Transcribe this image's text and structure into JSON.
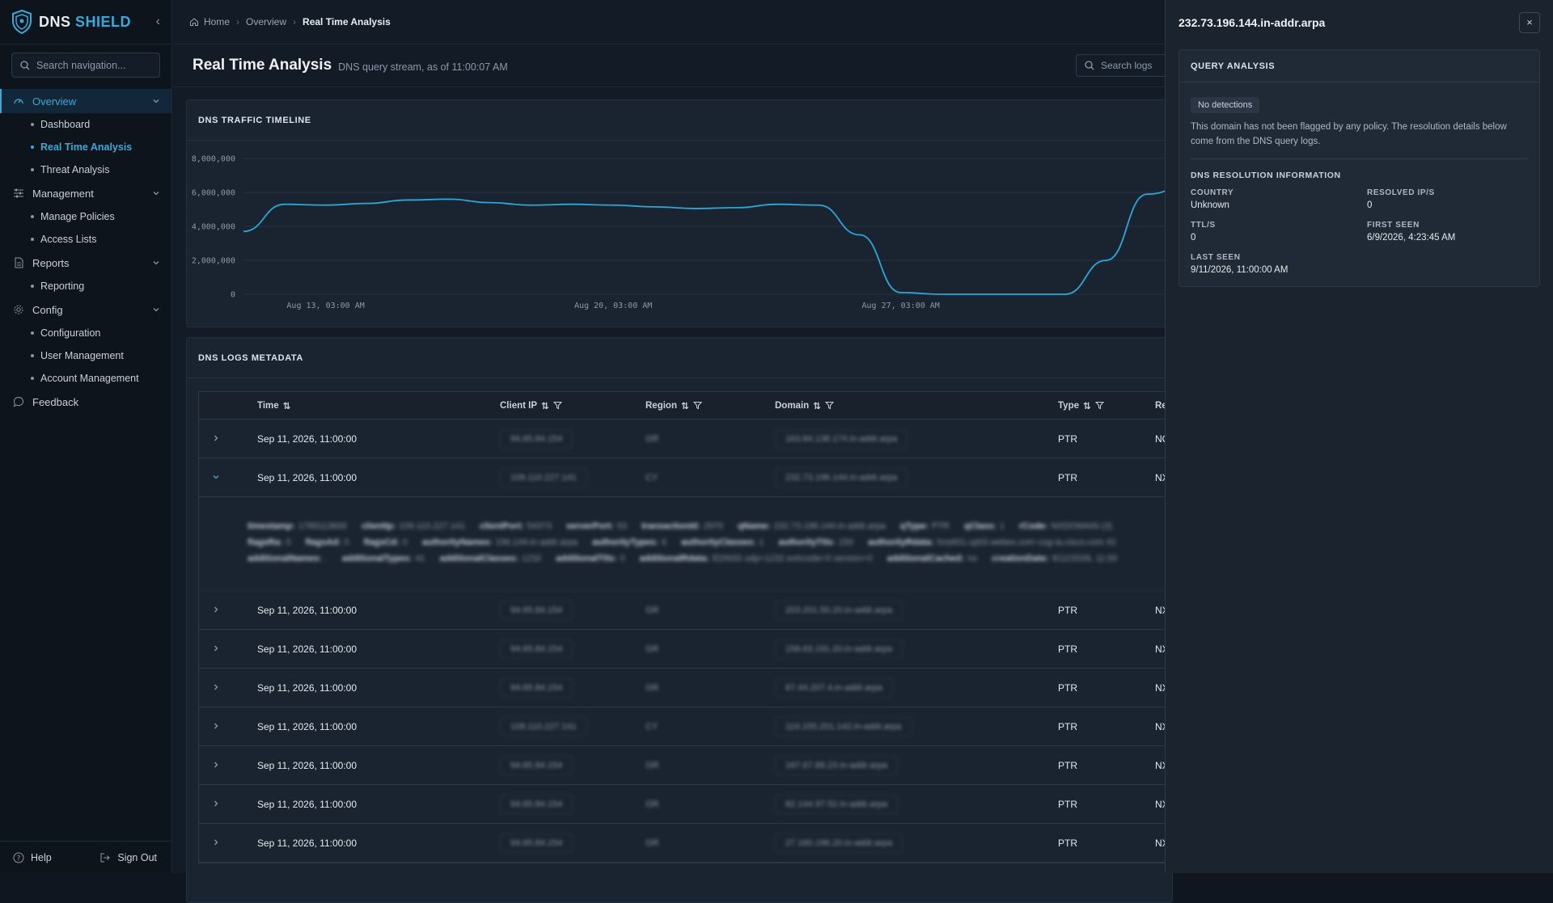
{
  "brand": {
    "name_part1": "DNS",
    "name_part2": "SHIELD"
  },
  "nav_search": {
    "placeholder": "Search navigation..."
  },
  "nav": {
    "overview": {
      "label": "Overview",
      "items": [
        "Dashboard",
        "Real Time Analysis",
        "Threat Analysis"
      ]
    },
    "management": {
      "label": "Management",
      "items": [
        "Manage Policies",
        "Access Lists"
      ]
    },
    "reports": {
      "label": "Reports",
      "items": [
        "Reporting"
      ]
    },
    "config": {
      "label": "Config",
      "items": [
        "Configuration",
        "User Management",
        "Account Management"
      ]
    },
    "feedback": {
      "label": "Feedback"
    }
  },
  "sidebar_footer": {
    "help": "Help",
    "sign_out": "Sign Out"
  },
  "breadcrumb": [
    "Home",
    "Overview",
    "Real Time Analysis"
  ],
  "page": {
    "title": "Real Time Analysis",
    "subtitle": "DNS query stream, as of 11:00:07 AM",
    "search_placeholder": "Search logs"
  },
  "timeline": {
    "heading": "DNS TRAFFIC TIMELINE"
  },
  "chart_data": {
    "type": "line",
    "x": [
      "Aug 11",
      "Aug 12",
      "Aug 13",
      "Aug 14",
      "Aug 15",
      "Aug 16",
      "Aug 17",
      "Aug 18",
      "Aug 19",
      "Aug 20",
      "Aug 21",
      "Aug 22",
      "Aug 23",
      "Aug 24",
      "Aug 25",
      "Aug 26",
      "Aug 27",
      "Aug 28",
      "Aug 29",
      "Aug 30",
      "Aug 31",
      "Sep 1",
      "Sep 2",
      "Sep 3",
      "Sep 4"
    ],
    "values": [
      3700000,
      5300000,
      5250000,
      5350000,
      5550000,
      5600000,
      5400000,
      5250000,
      5300000,
      5250000,
      5150000,
      5050000,
      5100000,
      5300000,
      5250000,
      3500000,
      100000,
      0,
      0,
      0,
      0,
      2000000,
      5900000,
      6400000,
      6100000
    ],
    "x_tick_labels": [
      "Aug 13, 03:00 AM",
      "Aug 20, 03:00 AM",
      "Aug 27, 03:00 AM"
    ],
    "y_ticks": [
      "8,000,000",
      "6,000,000",
      "4,000,000",
      "2,000,000",
      "0"
    ],
    "ylim": [
      0,
      8000000
    ],
    "color": "#29a8d9",
    "grid": true
  },
  "logs": {
    "heading": "DNS LOGS METADATA",
    "columns": {
      "time": "Time",
      "client_ip": "Client IP",
      "region": "Region",
      "domain": "Domain",
      "type": "Type",
      "response": "Re"
    },
    "rows": [
      {
        "time": "Sep 11, 2026, 11:00:00",
        "ip": "94.65.84.154",
        "region": "GR",
        "domain": "163.84.138.174.in-addr.arpa",
        "type": "PTR",
        "resp": "NO",
        "expanded": false
      },
      {
        "time": "Sep 11, 2026, 11:00:00",
        "ip": "109.110.227.141",
        "region": "CY",
        "domain": "232.73.196.144.in-addr.arpa",
        "type": "PTR",
        "resp": "NX",
        "expanded": true
      },
      {
        "time": "Sep 11, 2026, 11:00:00",
        "ip": "94.65.84.154",
        "region": "GR",
        "domain": "203.201.50.20.in-addr.arpa",
        "type": "PTR",
        "resp": "NX",
        "expanded": false
      },
      {
        "time": "Sep 11, 2026, 11:00:00",
        "ip": "94.65.84.154",
        "region": "GR",
        "domain": "158.63.191.20.in-addr.arpa",
        "type": "PTR",
        "resp": "NX",
        "expanded": false
      },
      {
        "time": "Sep 11, 2026, 11:00:00",
        "ip": "94.65.84.154",
        "region": "GR",
        "domain": "67.44.207.4.in-addr.arpa",
        "type": "PTR",
        "resp": "NX",
        "expanded": false
      },
      {
        "time": "Sep 11, 2026, 11:00:00",
        "ip": "109.110.227.141",
        "region": "CY",
        "domain": "119.155.201.142.in-addr.arpa",
        "type": "PTR",
        "resp": "NX",
        "expanded": false
      },
      {
        "time": "Sep 11, 2026, 11:00:00",
        "ip": "94.65.84.154",
        "region": "GR",
        "domain": "167.67.89.23.in-addr.arpa",
        "type": "PTR",
        "resp": "NX",
        "expanded": false
      },
      {
        "time": "Sep 11, 2026, 11:00:00",
        "ip": "94.65.84.154",
        "region": "GR",
        "domain": "82.144.97.52.in-addr.arpa",
        "type": "PTR",
        "resp": "NX",
        "expanded": false
      },
      {
        "time": "Sep 11, 2026, 11:00:00",
        "ip": "94.65.84.154",
        "region": "GR",
        "domain": "27.160.196.20.in-addr.arpa",
        "type": "PTR",
        "resp": "NX",
        "expanded": false
      }
    ],
    "expanded_detail": [
      [
        [
          "timestamp:",
          "1789113600"
        ],
        [
          "clientIp:",
          "109.110.227.141"
        ],
        [
          "clientPort:",
          "54373"
        ],
        [
          "serverPort:",
          "53"
        ],
        [
          "transactionId:",
          "2970"
        ],
        [
          "qName:",
          "232.73.196.144.in-addr.arpa"
        ],
        [
          "qType:",
          "PTR"
        ],
        [
          "qClass:",
          "1"
        ],
        [
          "rCode:",
          "NXDOMAIN (3)"
        ]
      ],
      [
        [
          "flagsRa:",
          "0"
        ],
        [
          "flagsAd:",
          "0"
        ],
        [
          "flagsCd:",
          "0"
        ],
        [
          "authorityNames:",
          "196.144.in-addr.arpa"
        ],
        [
          "authorityTypes:",
          "6"
        ],
        [
          "authorityClasses:",
          "1"
        ],
        [
          "authorityTtls:",
          "150"
        ],
        [
          "authorityRdata:",
          "hns601.cp03.webex.com cog-ia.cisco.com 41"
        ]
      ],
      [
        [
          "additionalNames:",
          "."
        ],
        [
          "additionalTypes:",
          "41"
        ],
        [
          "additionalClasses:",
          "1232"
        ],
        [
          "additionalTtls:",
          "0"
        ],
        [
          "additionalRdata:",
          "EDNS0 udp=1232 extrcode=0 version=0"
        ],
        [
          "additionalCached:",
          "no"
        ],
        [
          "creationDate:",
          "9/11/2026, 11:00"
        ]
      ]
    ]
  },
  "drawer": {
    "title": "232.73.196.144.in-addr.arpa",
    "close": "×",
    "query_analysis": "QUERY ANALYSIS",
    "badge": "No detections",
    "description": "This domain has not been flagged by any policy. The resolution details below come from the DNS query logs.",
    "resolution_title": "DNS RESOLUTION INFORMATION",
    "fields": [
      {
        "label": "COUNTRY",
        "value": "Unknown"
      },
      {
        "label": "RESOLVED IP/S",
        "value": "0"
      },
      {
        "label": "TTL/S",
        "value": "0"
      },
      {
        "label": "FIRST SEEN",
        "value": "6/9/2026, 4:23:45 AM"
      },
      {
        "label": "LAST SEEN",
        "value": "9/11/2026, 11:00:00 AM"
      }
    ]
  }
}
